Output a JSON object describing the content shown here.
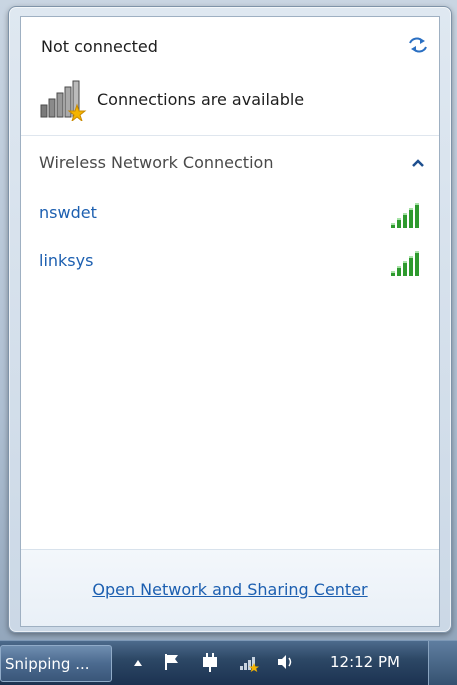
{
  "flyout": {
    "status_title": "Not connected",
    "availability_text": "Connections are available",
    "refresh_icon": "refresh-arrows-icon",
    "availability_icon": "signal-bars-with-star-icon"
  },
  "section": {
    "title": "Wireless Network Connection",
    "collapse_icon": "chevron-up-icon"
  },
  "networks": [
    {
      "name": "nswdet",
      "signal_icon": "signal-strength-icon",
      "signal_level": 1.0
    },
    {
      "name": "linksys",
      "signal_icon": "signal-strength-icon",
      "signal_level": 1.0
    }
  ],
  "footer": {
    "link_label": "Open Network and Sharing Center"
  },
  "taskbar": {
    "task_button_label": "Snipping ...",
    "tray_icons": [
      "show-hidden-icons-arrow",
      "action-center-flag-icon",
      "power-plug-icon",
      "network-icon",
      "volume-icon"
    ],
    "clock": "12:12 PM"
  },
  "colors": {
    "link": "#1c5fb0",
    "signal_green": "#2e9a2e",
    "taskbar": "#2d4866"
  }
}
